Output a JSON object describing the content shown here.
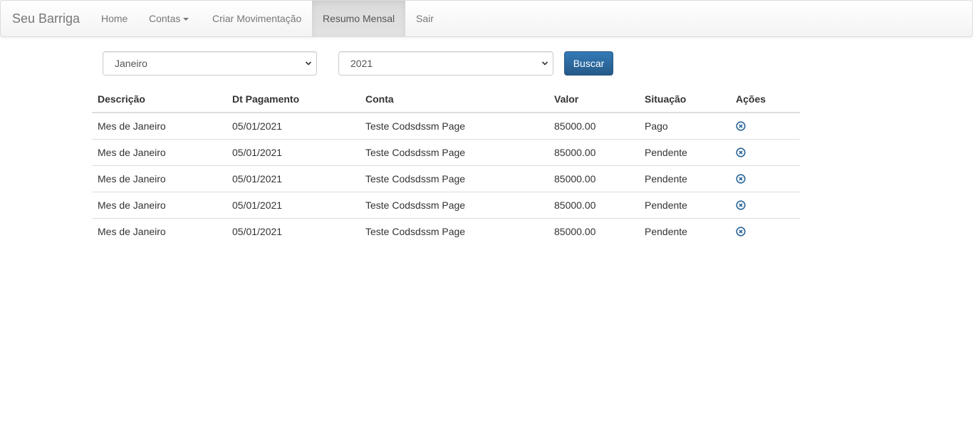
{
  "navbar": {
    "brand": "Seu Barriga",
    "items": [
      {
        "label": "Home"
      },
      {
        "label": "Contas"
      },
      {
        "label": "Criar Movimentação"
      },
      {
        "label": "Resumo Mensal"
      },
      {
        "label": "Sair"
      }
    ],
    "active": "Resumo Mensal"
  },
  "filters": {
    "month": {
      "selected": "Janeiro"
    },
    "year": {
      "selected": "2021"
    },
    "search_label": "Buscar"
  },
  "table": {
    "headers": [
      "Descrição",
      "Dt Pagamento",
      "Conta",
      "Valor",
      "Situação",
      "Ações"
    ],
    "rows": [
      {
        "descricao": "Mes de Janeiro",
        "data": "05/01/2021",
        "conta": "Teste Codsdssm Page",
        "valor": "85000.00",
        "situacao": "Pago"
      },
      {
        "descricao": "Mes de Janeiro",
        "data": "05/01/2021",
        "conta": "Teste Codsdssm Page",
        "valor": "85000.00",
        "situacao": "Pendente"
      },
      {
        "descricao": "Mes de Janeiro",
        "data": "05/01/2021",
        "conta": "Teste Codsdssm Page",
        "valor": "85000.00",
        "situacao": "Pendente"
      },
      {
        "descricao": "Mes de Janeiro",
        "data": "05/01/2021",
        "conta": "Teste Codsdssm Page",
        "valor": "85000.00",
        "situacao": "Pendente"
      },
      {
        "descricao": "Mes de Janeiro",
        "data": "05/01/2021",
        "conta": "Teste Codsdssm Page",
        "valor": "85000.00",
        "situacao": "Pendente"
      }
    ],
    "action_icon": "remove-circle-icon"
  },
  "colors": {
    "primary": "#337ab7",
    "pendente": "#ee1111",
    "pago": "#000000",
    "icon": "#2a6496"
  }
}
